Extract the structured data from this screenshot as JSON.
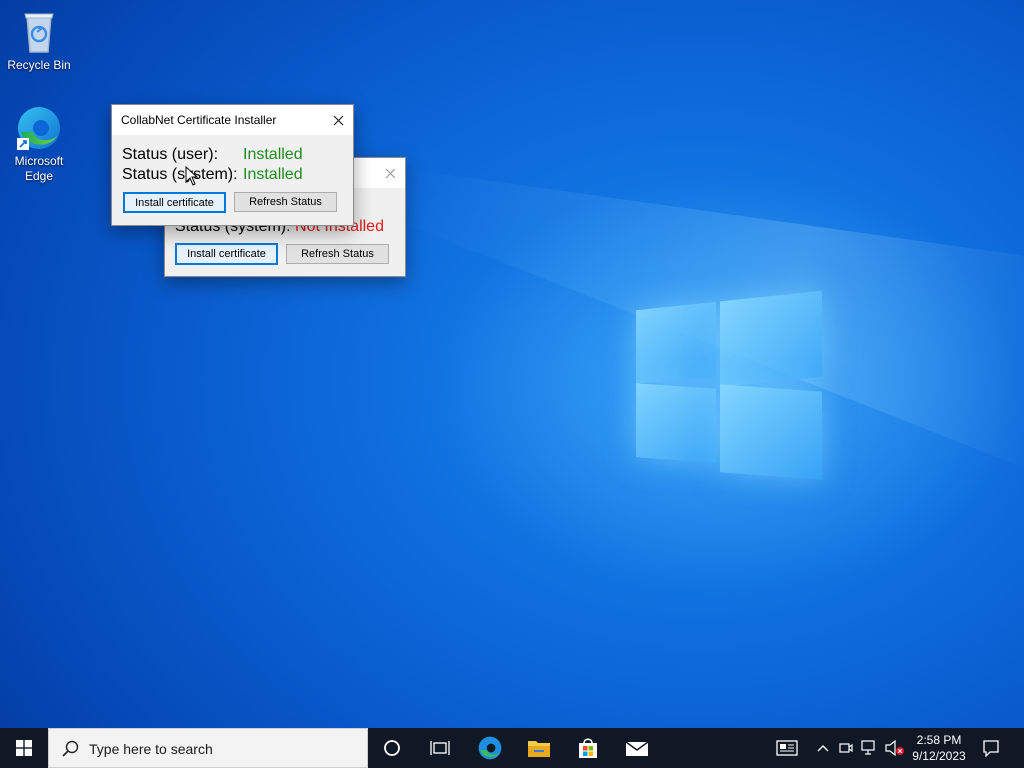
{
  "desktop": {
    "icons": [
      {
        "label": "Recycle Bin"
      },
      {
        "label": "Microsoft Edge"
      }
    ]
  },
  "dialog_back": {
    "status_system_label": "Status (system):",
    "status_system_value": "Not Installed",
    "install_label": "Install certificate",
    "refresh_label": "Refresh Status"
  },
  "dialog_front": {
    "title": "CollabNet Certificate Installer",
    "status_user_label": "Status (user):",
    "status_user_value": "Installed",
    "status_system_label": "Status (system):",
    "status_system_value": "Installed",
    "install_label": "Install certificate",
    "refresh_label": "Refresh Status"
  },
  "taskbar": {
    "search_placeholder": "Type here to search",
    "time": "2:58 PM",
    "date": "9/12/2023"
  },
  "colors": {
    "installed": "#1f8a1f",
    "not_installed": "#e21b1b",
    "accent": "#0078d7",
    "taskbar": "#101825"
  }
}
